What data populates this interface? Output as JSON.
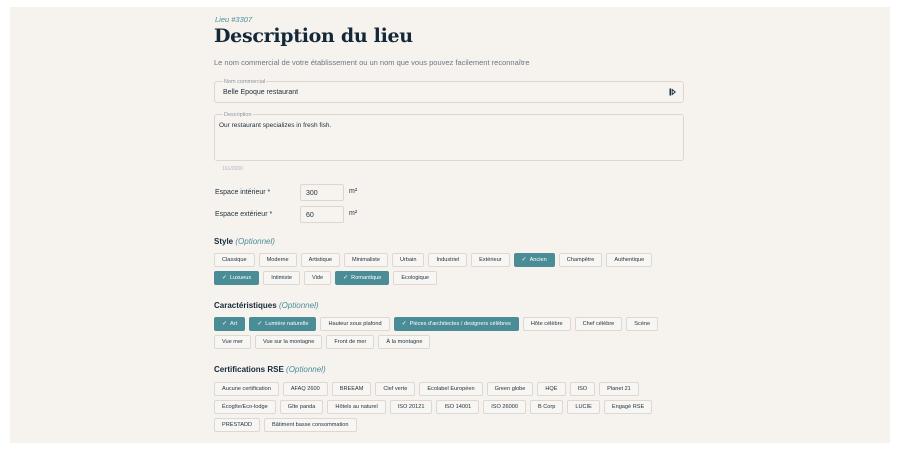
{
  "header": {
    "lieu_id": "Lieu #3307",
    "title": "Description du lieu",
    "subtitle": "Le nom commercial de votre établissement ou un nom que vous pouvez facilement reconnaître"
  },
  "name_field": {
    "label": "Nom commercial",
    "value": "Belle Epoque restaurant",
    "icon": "text-cursor-icon"
  },
  "description_field": {
    "label": "Description",
    "value": "Our restaurant specializes in fresh fish.",
    "char_count": "161/2000"
  },
  "spaces": {
    "interior": {
      "label": "Espace intérieur *",
      "value": "300",
      "unit": "m²"
    },
    "exterior": {
      "label": "Espace extérieur *",
      "value": "60",
      "unit": "m²"
    }
  },
  "style": {
    "title": "Style",
    "optional": "(Optionnel)",
    "chips": [
      {
        "label": "Classique",
        "selected": false
      },
      {
        "label": "Moderne",
        "selected": false
      },
      {
        "label": "Artistique",
        "selected": false
      },
      {
        "label": "Minimaliste",
        "selected": false
      },
      {
        "label": "Urbain",
        "selected": false
      },
      {
        "label": "Industriel",
        "selected": false
      },
      {
        "label": "Extérieur",
        "selected": false
      },
      {
        "label": "Ancien",
        "selected": true
      },
      {
        "label": "Champêtre",
        "selected": false
      },
      {
        "label": "Authentique",
        "selected": false
      },
      {
        "label": "Luxueux",
        "selected": true
      },
      {
        "label": "Intimiste",
        "selected": false
      },
      {
        "label": "Vide",
        "selected": false
      },
      {
        "label": "Romantique",
        "selected": true
      },
      {
        "label": "Ecologique",
        "selected": false
      }
    ]
  },
  "characteristics": {
    "title": "Caractéristiques",
    "optional": "(Optionnel)",
    "chips": [
      {
        "label": "Art",
        "selected": true
      },
      {
        "label": "Lumière naturelle",
        "selected": true
      },
      {
        "label": "Hauteur sous plafond",
        "selected": false
      },
      {
        "label": "Pièces d'architectes / designers célèbres",
        "selected": true
      },
      {
        "label": "Hôte célèbre",
        "selected": false
      },
      {
        "label": "Chef célèbre",
        "selected": false
      },
      {
        "label": "Scène",
        "selected": false
      },
      {
        "label": "Vue mer",
        "selected": false
      },
      {
        "label": "Vue sur la montagne",
        "selected": false
      },
      {
        "label": "Front de mer",
        "selected": false
      },
      {
        "label": "À la montagne",
        "selected": false
      }
    ]
  },
  "rse": {
    "title": "Certifications RSE",
    "optional": "(Optionnel)",
    "chips": [
      {
        "label": "Aucune certification",
        "selected": false
      },
      {
        "label": "AFAQ 2600",
        "selected": false
      },
      {
        "label": "BREEAM",
        "selected": false
      },
      {
        "label": "Clef verte",
        "selected": false
      },
      {
        "label": "Ecolabel Européen",
        "selected": false
      },
      {
        "label": "Green globe",
        "selected": false
      },
      {
        "label": "HQE",
        "selected": false
      },
      {
        "label": "ISO",
        "selected": false
      },
      {
        "label": "Planet 21",
        "selected": false
      },
      {
        "label": "Écogîte/Eco-lodge",
        "selected": false
      },
      {
        "label": "Gîte panda",
        "selected": false
      },
      {
        "label": "Hôtels au naturel",
        "selected": false
      },
      {
        "label": "ISO 20121",
        "selected": false
      },
      {
        "label": "ISO 14001",
        "selected": false
      },
      {
        "label": "ISO 26000",
        "selected": false
      },
      {
        "label": "B Corp",
        "selected": false
      },
      {
        "label": "LUCIE",
        "selected": false
      },
      {
        "label": "Engagé RSE",
        "selected": false
      },
      {
        "label": "PRESTADD",
        "selected": false
      },
      {
        "label": "Bâtiment basse consommation",
        "selected": false
      }
    ]
  },
  "colors": {
    "accent": "#4a8d96",
    "background": "#f6f3ef",
    "text": "#1c2f3a"
  }
}
